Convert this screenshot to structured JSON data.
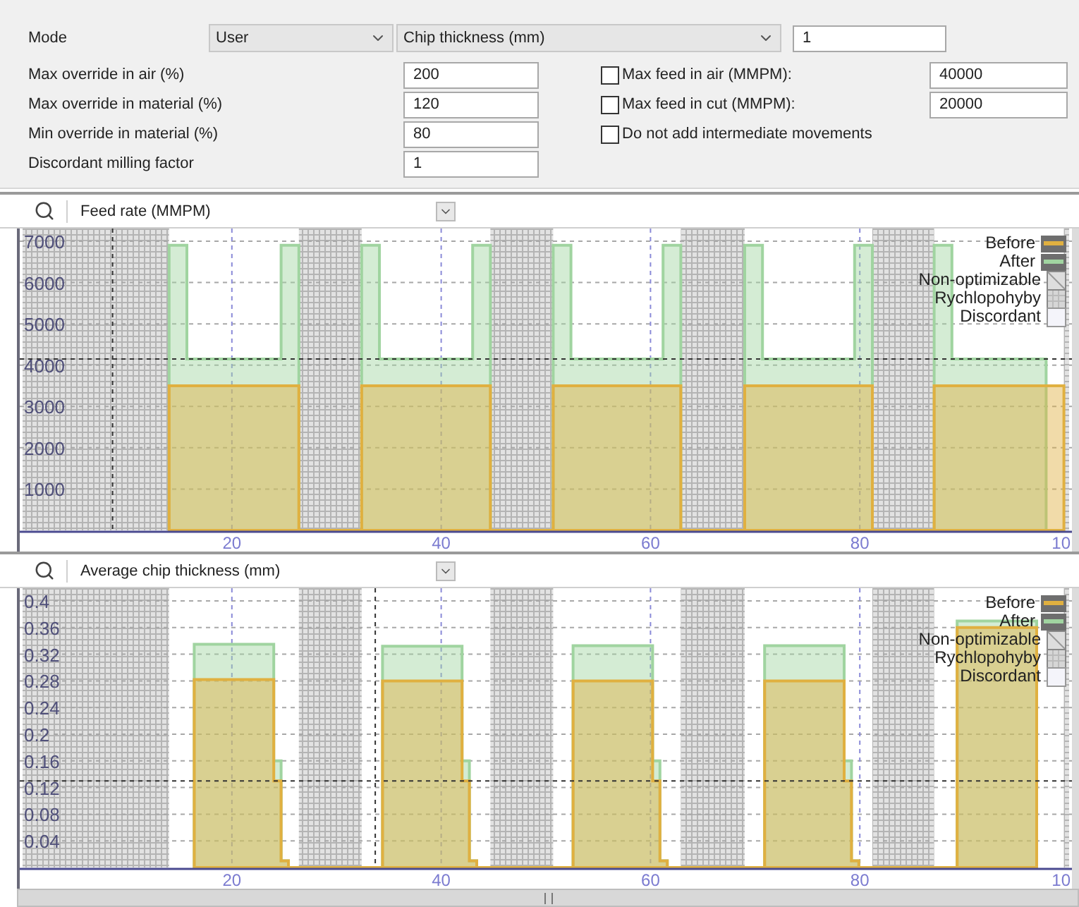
{
  "settings": {
    "mode_label": "Mode",
    "mode_select": {
      "value": "User"
    },
    "criterion_select": {
      "value": "Chip thickness (mm)"
    },
    "criterion_value": "1",
    "fields": [
      {
        "label": "Max override in air (%)",
        "value": "200"
      },
      {
        "label": "Max override in material (%)",
        "value": "120"
      },
      {
        "label": "Min override in material (%)",
        "value": "80"
      },
      {
        "label": "Discordant milling factor",
        "value": "1"
      }
    ],
    "options": [
      {
        "label": "Max feed in air (MMPM):",
        "checked": false,
        "value": "40000"
      },
      {
        "label": "Max feed in cut (MMPM):",
        "checked": false,
        "value": "20000"
      },
      {
        "label": "Do not add intermediate movements",
        "checked": false
      }
    ]
  },
  "charts": [
    {
      "selector": {
        "value": "Feed rate (MMPM)"
      },
      "pattern_legend": [
        {
          "label": "Non-optimizable",
          "kind": "hatch"
        },
        {
          "label": "Rychlopohyby",
          "kind": "grid"
        },
        {
          "label": "Discordant",
          "kind": "dots"
        }
      ],
      "cut_tick_label": "10",
      "chart_data": {
        "type": "area",
        "xlim": [
          0,
          100
        ],
        "ylim": [
          0,
          7000
        ],
        "grid": true,
        "legend": true,
        "xticks": [
          20,
          40,
          60,
          80
        ],
        "yticks": [
          1000,
          2000,
          3000,
          4000,
          5000,
          6000,
          7000
        ],
        "x": [
          14,
          14,
          15.7,
          15.7,
          24.7,
          24.7,
          26.4,
          26.4,
          32.4,
          32.4,
          34.1,
          34.1,
          43,
          43,
          44.7,
          44.7,
          50.7,
          50.7,
          52.4,
          52.4,
          61.2,
          61.2,
          62.9,
          62.9,
          69,
          69,
          70.7,
          70.7,
          79.5,
          79.5,
          81.2,
          81.2,
          87.1,
          87.1,
          88.8,
          88.8,
          97.8,
          97.8,
          99.5,
          99.5
        ],
        "series": [
          {
            "name": "Before",
            "color": "#e0b040",
            "values": [
              0,
              3500,
              3500,
              3500,
              3500,
              3500,
              3500,
              0,
              0,
              3500,
              3500,
              3500,
              3500,
              3500,
              3500,
              0,
              0,
              3500,
              3500,
              3500,
              3500,
              3500,
              3500,
              0,
              0,
              3500,
              3500,
              3500,
              3500,
              3500,
              3500,
              0,
              0,
              3500,
              3500,
              3500,
              3500,
              3500,
              3500,
              0
            ]
          },
          {
            "name": "After",
            "color": "#a0d4a0",
            "values": [
              0,
              6900,
              6900,
              4150,
              4150,
              6900,
              6900,
              0,
              0,
              6900,
              6900,
              4150,
              4150,
              6900,
              6900,
              0,
              0,
              6900,
              6900,
              4150,
              4150,
              6900,
              6900,
              0,
              0,
              6900,
              6900,
              4150,
              4150,
              6900,
              6900,
              0,
              0,
              6900,
              6900,
              4150,
              4150,
              null,
              null,
              0
            ]
          }
        ],
        "bands": [
          {
            "axis": "x",
            "from": 0,
            "to": 14
          },
          {
            "axis": "x",
            "from": 26.4,
            "to": 32.4
          },
          {
            "axis": "x",
            "from": 44.7,
            "to": 50.7
          },
          {
            "axis": "x",
            "from": 62.9,
            "to": 69
          },
          {
            "axis": "x",
            "from": 81.2,
            "to": 87.1
          },
          {
            "axis": "x",
            "from": 99.5,
            "to": 100
          }
        ],
        "ref_lines": [
          {
            "axis": "x",
            "value": 8.6
          },
          {
            "axis": "y",
            "value": 4150
          }
        ]
      }
    },
    {
      "selector": {
        "value": "Average chip thickness (mm)"
      },
      "pattern_legend": [
        {
          "label": "Non-optimizable",
          "kind": "hatch"
        },
        {
          "label": "Rychlopohyby",
          "kind": "grid"
        },
        {
          "label": "Discordant",
          "kind": "dots"
        }
      ],
      "cut_tick_label": "10",
      "chart_data": {
        "type": "area",
        "xlim": [
          0,
          100
        ],
        "ylim": [
          0,
          0.4
        ],
        "grid": true,
        "legend": true,
        "xticks": [
          20,
          40,
          60,
          80
        ],
        "yticks": [
          {
            "value": 0.04,
            "label": "0.04"
          },
          {
            "value": 0.08,
            "label": "0.08"
          },
          {
            "value": 0.12,
            "label": "0.12"
          },
          {
            "value": 0.16,
            "label": "0.16"
          },
          {
            "value": 0.2,
            "label": "0.2"
          },
          {
            "value": 0.24,
            "label": "0.24"
          },
          {
            "value": 0.28,
            "label": "0.28"
          },
          {
            "value": 0.32,
            "label": "0.32"
          },
          {
            "value": 0.36,
            "label": "0.36"
          },
          {
            "value": 0.4,
            "label": "0.4"
          }
        ],
        "x": [
          16.4,
          16.4,
          24,
          24,
          24.7,
          24.7,
          25.4,
          25.4,
          34.4,
          34.4,
          42,
          42,
          42.7,
          42.7,
          43.4,
          43.4,
          52.6,
          52.6,
          60.2,
          60.2,
          60.9,
          60.9,
          61.6,
          61.6,
          70.9,
          70.9,
          78.5,
          78.5,
          79.2,
          79.2,
          79.9,
          79.9,
          89.3,
          89.3,
          96.9,
          96.9
        ],
        "series": [
          {
            "name": "Before",
            "color": "#e0b040",
            "values": [
              0,
              0.282,
              0.282,
              0.13,
              0.13,
              0.01,
              0.01,
              0,
              0,
              0.28,
              0.28,
              0.13,
              0.13,
              0.01,
              0.01,
              0,
              0,
              0.28,
              0.28,
              0.13,
              0.13,
              0.01,
              0.01,
              0,
              0,
              0.28,
              0.28,
              0.13,
              0.13,
              0.01,
              0.01,
              0,
              0,
              0.36,
              0.36,
              0
            ]
          },
          {
            "name": "After",
            "color": "#a0d4a0",
            "values": [
              0,
              0.335,
              0.335,
              0.16,
              0.16,
              0.01,
              0.01,
              0,
              0,
              0.332,
              0.332,
              0.16,
              0.16,
              0.01,
              0.01,
              0,
              0,
              0.333,
              0.333,
              0.16,
              0.16,
              0.01,
              0.01,
              0,
              0,
              0.333,
              0.333,
              0.16,
              0.16,
              0.01,
              0.01,
              0,
              0,
              0.37,
              0.37,
              0
            ]
          }
        ],
        "bands": [
          {
            "axis": "x",
            "from": 0,
            "to": 14
          },
          {
            "axis": "x",
            "from": 26.4,
            "to": 32.4
          },
          {
            "axis": "x",
            "from": 44.7,
            "to": 50.7
          },
          {
            "axis": "x",
            "from": 62.9,
            "to": 69
          },
          {
            "axis": "x",
            "from": 81.2,
            "to": 87.1
          },
          {
            "axis": "x",
            "from": 99.5,
            "to": 100
          }
        ],
        "ref_lines": [
          {
            "axis": "x",
            "value": 33.7
          },
          {
            "axis": "y",
            "value": 0.13
          }
        ]
      }
    }
  ]
}
